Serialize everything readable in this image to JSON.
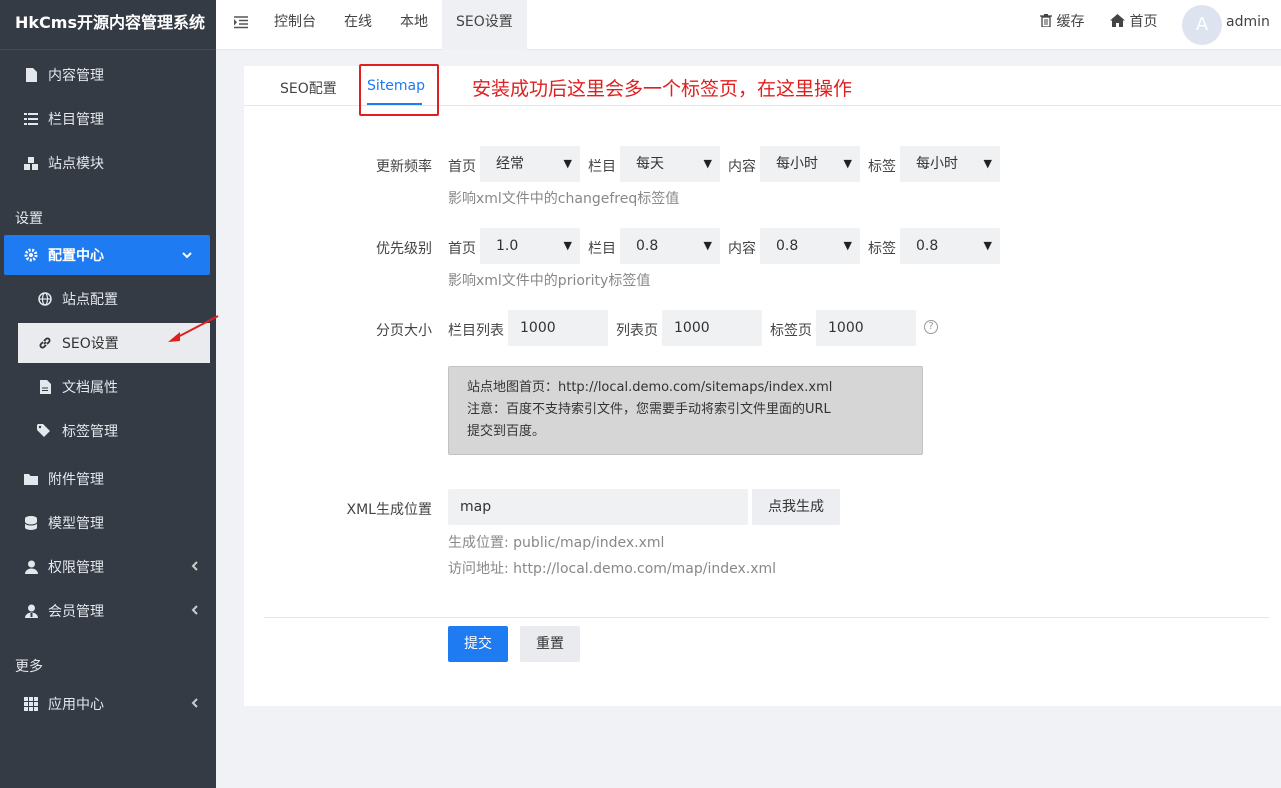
{
  "app": {
    "title": "HkCms开源内容管理系统"
  },
  "sidebar": {
    "items": [
      {
        "label": "内容管理",
        "icon": "file-icon"
      },
      {
        "label": "栏目管理",
        "icon": "list-icon"
      },
      {
        "label": "站点模块",
        "icon": "cubes-icon"
      }
    ],
    "group_settings": "设置",
    "config_center": "配置中心",
    "sub_items": [
      {
        "label": "站点配置",
        "icon": "globe-icon"
      },
      {
        "label": "SEO设置",
        "icon": "link-icon"
      },
      {
        "label": "文档属性",
        "icon": "file-text-icon"
      },
      {
        "label": "标签管理",
        "icon": "tags-icon"
      }
    ],
    "items2": [
      {
        "label": "附件管理",
        "icon": "folder-icon"
      },
      {
        "label": "模型管理",
        "icon": "database-icon"
      },
      {
        "label": "权限管理",
        "icon": "user-icon"
      },
      {
        "label": "会员管理",
        "icon": "users-icon"
      }
    ],
    "group_more": "更多",
    "app_center": "应用中心"
  },
  "topbar": {
    "tabs": [
      "控制台",
      "在线",
      "本地",
      "SEO设置"
    ],
    "cache": "缓存",
    "home": "首页",
    "avatar_letter": "A",
    "username": "admin"
  },
  "card": {
    "tabs": [
      "SEO配置",
      "Sitemap"
    ],
    "annotation": "安装成功后这里会多一个标签页，在这里操作"
  },
  "form": {
    "freq_label": "更新频率",
    "priority_label": "优先级别",
    "page_label": "分页大小",
    "xml_label": "XML生成位置",
    "f_home": "首页",
    "f_column": "栏目",
    "f_content": "内容",
    "f_tag": "标签",
    "freq_values": [
      "经常",
      "每天",
      "每小时",
      "每小时"
    ],
    "freq_hint": "影响xml文件中的changefreq标签值",
    "priority_values": [
      "1.0",
      "0.8",
      "0.8",
      "0.8"
    ],
    "priority_hint": "影响xml文件中的priority标签值",
    "page_col_list": "栏目列表",
    "page_list": "列表页",
    "page_tag": "标签页",
    "page_values": [
      "1000",
      "1000",
      "1000"
    ],
    "info_line1": "站点地图首页：http://local.demo.com/sitemaps/index.xml",
    "info_line2": "注意：百度不支持索引文件，您需要手动将索引文件里面的URL",
    "info_line3": "提交到百度。",
    "xml_value": "map",
    "generate": "点我生成",
    "gen_pos": "生成位置: public/map/index.xml",
    "visit_url": "访问地址: http://local.demo.com/map/index.xml",
    "submit": "提交",
    "reset": "重置"
  },
  "colors": {
    "accent": "#1e7bf1",
    "sidebar": "#353b45",
    "annotation": "#e02020"
  }
}
